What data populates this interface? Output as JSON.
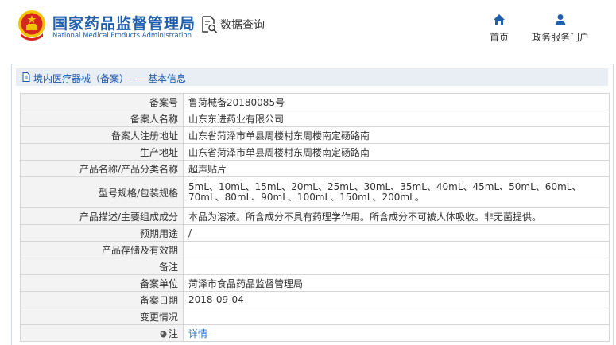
{
  "header": {
    "site_name_cn": "国家药品监督管理局",
    "site_name_en": "National Medical Products Administration",
    "data_query_label": "数据查询",
    "nav": {
      "home": "首页",
      "portal": "政务服务门户"
    },
    "colors": {
      "brand_blue": "#1f5fae",
      "emblem_red": "#d7261f",
      "emblem_gold": "#f2c400"
    }
  },
  "panel": {
    "title": "境内医疗器械（备案）——基本信息"
  },
  "rows": [
    {
      "key": "备案号",
      "value": "鲁菏械备20180085号"
    },
    {
      "key": "备案人名称",
      "value": "山东东进药业有限公司"
    },
    {
      "key": "备案人注册地址",
      "value": "山东省菏泽市单县周楼村东周楼南定砀路南"
    },
    {
      "key": "生产地址",
      "value": "山东省菏泽市单县周楼村东周楼南定砀路南"
    },
    {
      "key": "产品名称/产品分类名称",
      "value": "超声贴片"
    },
    {
      "key": "型号规格/包装规格",
      "value": "5mL、10mL、15mL、20mL、25mL、30mL、35mL、40mL、45mL、50mL、60mL、70mL、80mL、90mL、100mL、150mL、200mL。"
    },
    {
      "key": "产品描述/主要组成成分",
      "value": "本品为溶液。所含成分不具有药理学作用。所含成分不可被人体吸收。非无菌提供。"
    },
    {
      "key": "预期用途",
      "value": "/"
    },
    {
      "key": "产品存储及有效期",
      "value": ""
    },
    {
      "key": "备注",
      "value": ""
    },
    {
      "key": "备案单位",
      "value": "菏泽市食品药品监督管理局"
    },
    {
      "key": "备案日期",
      "value": "2018-09-04"
    },
    {
      "key": "变更情况",
      "value": ""
    },
    {
      "key": "注",
      "value": "详情"
    }
  ]
}
